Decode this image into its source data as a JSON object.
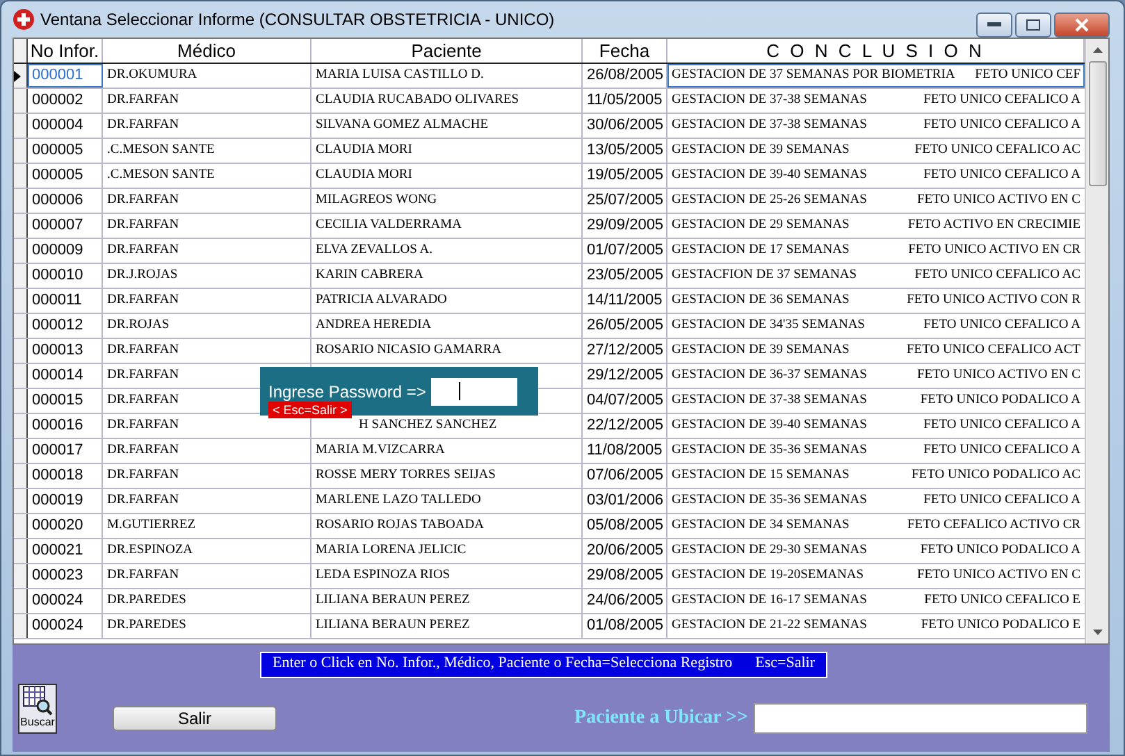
{
  "window": {
    "title": "Ventana Seleccionar Informe (CONSULTAR OBSTETRICIA - UNICO)"
  },
  "table": {
    "columns": [
      "No Infor.",
      "Médico",
      "Paciente",
      "Fecha",
      "C O N C L U S I O N"
    ],
    "rows": [
      {
        "selected": true,
        "no": "000001",
        "medico": "DR.OKUMURA",
        "paciente": "MARIA LUISA CASTILLO D.",
        "fecha": "26/08/2005",
        "gestacion": "GESTACION DE 37 SEMANAS POR BIOMETRIA",
        "feto": "FETO UNICO CEF"
      },
      {
        "selected": false,
        "no": "000002",
        "medico": "DR.FARFAN",
        "paciente": "CLAUDIA RUCABADO OLIVARES",
        "fecha": "11/05/2005",
        "gestacion": "GESTACION DE 37-38 SEMANAS",
        "feto": "FETO UNICO CEFALICO A"
      },
      {
        "selected": false,
        "no": "000004",
        "medico": "DR.FARFAN",
        "paciente": "SILVANA  GOMEZ ALMACHE",
        "fecha": "30/06/2005",
        "gestacion": "GESTACION DE 37-38 SEMANAS",
        "feto": "FETO UNICO CEFALICO A"
      },
      {
        "selected": false,
        "no": "000005",
        "medico": ".C.MESON SANTE",
        "paciente": "CLAUDIA MORI",
        "fecha": "13/05/2005",
        "gestacion": "GESTACION DE 39 SEMANAS",
        "feto": "FETO UNICO CEFALICO AC"
      },
      {
        "selected": false,
        "no": "000005",
        "medico": ".C.MESON SANTE",
        "paciente": "CLAUDIA MORI",
        "fecha": "19/05/2005",
        "gestacion": "GESTACION DE 39-40 SEMANAS",
        "feto": "FETO UNICO CEFALICO A"
      },
      {
        "selected": false,
        "no": "000006",
        "medico": "DR.FARFAN",
        "paciente": "MILAGREOS WONG",
        "fecha": "25/07/2005",
        "gestacion": "GESTACION DE 25-26 SEMANAS",
        "feto": "FETO UNICO ACTIVO EN C"
      },
      {
        "selected": false,
        "no": "000007",
        "medico": "DR.FARFAN",
        "paciente": "CECILIA VALDERRAMA",
        "fecha": "29/09/2005",
        "gestacion": "GESTACION DE 29 SEMANAS",
        "feto": "FETO ACTIVO EN CRECIMIE"
      },
      {
        "selected": false,
        "no": "000009",
        "medico": "DR.FARFAN",
        "paciente": "ELVA ZEVALLOS A.",
        "fecha": "01/07/2005",
        "gestacion": "GESTACION DE 17 SEMANAS",
        "feto": "FETO UNICO ACTIVO EN CR"
      },
      {
        "selected": false,
        "no": "000010",
        "medico": "DR.J.ROJAS",
        "paciente": "KARIN CABRERA",
        "fecha": "23/05/2005",
        "gestacion": "GESTACFION DE 37 SEMANAS",
        "feto": "FETO UNICO CEFALICO AC"
      },
      {
        "selected": false,
        "no": "000011",
        "medico": "DR.FARFAN",
        "paciente": "PATRICIA ALVARADO",
        "fecha": "14/11/2005",
        "gestacion": "GESTACION DE 36 SEMANAS",
        "feto": "FETO UNICO  ACTIVO CON R"
      },
      {
        "selected": false,
        "no": "000012",
        "medico": "DR.ROJAS",
        "paciente": "ANDREA HEREDIA",
        "fecha": "26/05/2005",
        "gestacion": "GESTACION DE 34'35 SEMANAS",
        "feto": "FETO UNICO CEFALICO A"
      },
      {
        "selected": false,
        "no": "000013",
        "medico": "DR.FARFAN",
        "paciente": "ROSARIO NICASIO GAMARRA",
        "fecha": "27/12/2005",
        "gestacion": "GESTACION DE 39 SEMANAS",
        "feto": "FETO UNICO CEFALICO ACT"
      },
      {
        "selected": false,
        "no": "000014",
        "medico": "DR.FARFAN",
        "fecha": "29/12/2005",
        "gestacion": "GESTACION DE 36-37  SEMANAS",
        "feto": "FETO UNICO ACTIVO EN C"
      },
      {
        "selected": false,
        "no": "000015",
        "medico": "DR.FARFAN",
        "fecha": "04/07/2005",
        "gestacion": "GESTACION DE 37-38 SEMANAS",
        "feto": "FETO UNICO PODALICO A"
      },
      {
        "selected": false,
        "no": "000016",
        "medico": "DR.FARFAN",
        "paciente": "H SANCHEZ SANCHEZ",
        "covered": true,
        "fecha": "22/12/2005",
        "gestacion": "GESTACION DE 39-40 SEMANAS",
        "feto": "FETO UNICO CEFALICO A"
      },
      {
        "selected": false,
        "no": "000017",
        "medico": "DR.FARFAN",
        "paciente": "MARIA M.VIZCARRA",
        "fecha": "11/08/2005",
        "gestacion": "GESTACION DE 35-36 SEMANAS",
        "feto": "FETO UNICO CEFALICO A"
      },
      {
        "selected": false,
        "no": "000018",
        "medico": "DR.FARFAN",
        "paciente": "ROSSE MERY TORRES SEIJAS",
        "fecha": "07/06/2005",
        "gestacion": "GESTACION DE 15 SEMANAS",
        "feto": "FETO UNICO  PODALICO AC"
      },
      {
        "selected": false,
        "no": "000019",
        "medico": "DR.FARFAN",
        "paciente": "MARLENE LAZO TALLEDO",
        "fecha": "03/01/2006",
        "gestacion": "GESTACION DE 35-36 SEMANAS",
        "feto": "FETO UNICO CEFALICO A"
      },
      {
        "selected": false,
        "no": "000020",
        "medico": "M.GUTIERREZ",
        "paciente": "ROSARIO  ROJAS TABOADA",
        "fecha": "05/08/2005",
        "gestacion": "GESTACION DE 34 SEMANAS",
        "feto": "FETO CEFALICO ACTIVO CR"
      },
      {
        "selected": false,
        "no": "000021",
        "medico": "DR.ESPINOZA",
        "paciente": "MARIA LORENA JELICIC",
        "fecha": "20/06/2005",
        "gestacion": "GESTACION DE 29-30 SEMANAS",
        "feto": "FETO UNICO PODALICO A"
      },
      {
        "selected": false,
        "no": "000023",
        "medico": "DR.FARFAN",
        "paciente": "LEDA ESPINOZA RIOS",
        "fecha": "29/08/2005",
        "gestacion": "GESTACION DE 19-20SEMANAS",
        "feto": "FETO UNICO ACTIVO EN C"
      },
      {
        "selected": false,
        "no": "000024",
        "medico": "DR.PAREDES",
        "paciente": "LILIANA BERAUN PEREZ",
        "fecha": "24/06/2005",
        "gestacion": "GESTACION DE 16-17 SEMANAS",
        "feto": "FETO UNICO CEFALICO E"
      },
      {
        "selected": false,
        "no": "000024",
        "medico": "DR.PAREDES",
        "paciente": "LILIANA BERAUN PEREZ",
        "fecha": "01/08/2005",
        "gestacion": "GESTACION DE 21-22 SEMANAS",
        "feto": "FETO UNICO PODALICO E"
      }
    ]
  },
  "password_dialog": {
    "label": "Ingrese Password =>",
    "hint": "< Esc=Salir >"
  },
  "status_hint": "Enter o Click en No. Infor., Médico, Paciente o Fecha=Selecciona Registro      Esc=Salir",
  "buscar": {
    "label": "Buscar"
  },
  "salir_button": "Salir",
  "search": {
    "label": "Paciente a Ubicar >>"
  }
}
